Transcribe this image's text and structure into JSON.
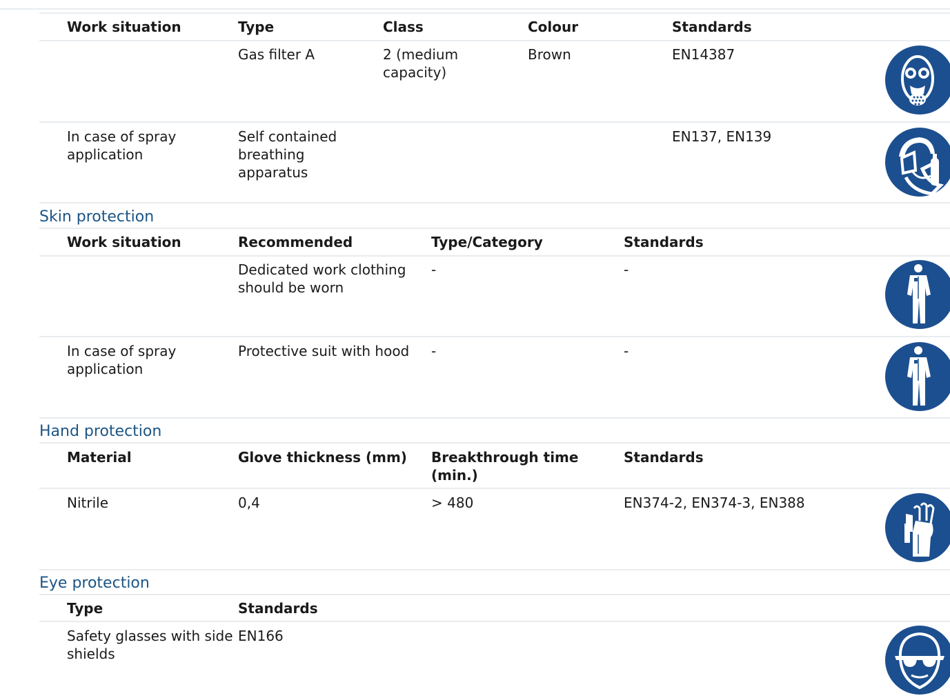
{
  "respiratory": {
    "headers": [
      "Work situation",
      "Type",
      "Class",
      "Colour",
      "Standards"
    ],
    "rows": [
      {
        "work_situation": "",
        "type": "Gas filter A",
        "class": "2 (medium capacity)",
        "colour": "Brown",
        "standards": "EN14387",
        "icon": "gas-mask-icon"
      },
      {
        "work_situation": "In case of spray application",
        "type": "Self contained breathing apparatus",
        "class": "",
        "colour": "",
        "standards": "EN137, EN139",
        "icon": "breathing-apparatus-icon"
      }
    ]
  },
  "skin": {
    "title": "Skin protection",
    "headers": [
      "Work situation",
      "Recommended",
      "Type/Category",
      "Standards"
    ],
    "rows": [
      {
        "work_situation": "",
        "recommended": "Dedicated work clothing should be worn",
        "type_category": "-",
        "standards": "-",
        "icon": "protective-clothing-icon"
      },
      {
        "work_situation": "In case of spray application",
        "recommended": "Protective suit with hood",
        "type_category": "-",
        "standards": "-",
        "icon": "protective-clothing-icon"
      }
    ]
  },
  "hand": {
    "title": "Hand protection",
    "headers": [
      "Material",
      "Glove thickness (mm)",
      "Breakthrough time (min.)",
      "Standards"
    ],
    "rows": [
      {
        "material": "Nitrile",
        "thickness": "0,4",
        "breakthrough": "> 480",
        "standards": "EN374-2, EN374-3, EN388",
        "icon": "gloves-icon"
      }
    ]
  },
  "eye": {
    "title": "Eye protection",
    "headers": [
      "Type",
      "Standards"
    ],
    "rows": [
      {
        "type": "Safety glasses with side shields",
        "standards": "EN166",
        "icon": "safety-glasses-icon"
      }
    ]
  },
  "colors": {
    "icon_blue": "#1c4f8f",
    "section_title": "#1c5585",
    "divider": "#e8ecef"
  }
}
